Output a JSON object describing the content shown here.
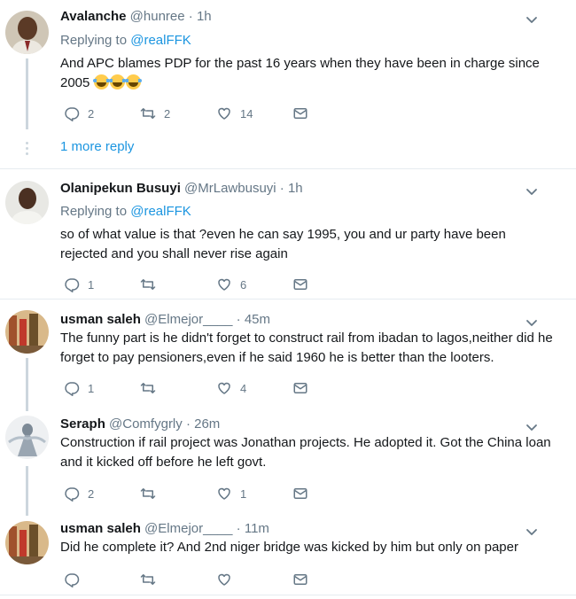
{
  "tweets": [
    {
      "name": "Avalanche",
      "handle": "@hunree",
      "dot": "·",
      "time": "1h",
      "replying_label": "Replying to ",
      "replying_to": "@realFFK",
      "text": "And APC blames PDP for the past 16 years when they have been in charge since 2005 ",
      "emojis": "😂😂😂",
      "replies": "2",
      "retweets": "2",
      "likes": "14",
      "more_reply": "1 more reply"
    },
    {
      "name": "Olanipekun Busuyi",
      "handle": "@MrLawbusuyi",
      "dot": "·",
      "time": "1h",
      "replying_label": "Replying to ",
      "replying_to": "@realFFK",
      "text": "so of what value is that ?even he can say 1995, you and ur party have been rejected and you shall never rise again",
      "replies": "1",
      "retweets": "",
      "likes": "6"
    },
    {
      "name": "usman saleh",
      "handle": "@Elmejor____",
      "dot": "·",
      "time": "45m",
      "text": "The funny part is he didn't forget to construct rail from ibadan to lagos,neither did he forget to pay pensioners,even if he said 1960 he is better than the looters.",
      "replies": "1",
      "retweets": "",
      "likes": "4"
    },
    {
      "name": "Seraph",
      "handle": "@Comfygrly",
      "dot": "·",
      "time": "26m",
      "text": "Construction if rail project was Jonathan projects. He adopted it. Got the China loan and it kicked off before he left govt.",
      "replies": "2",
      "retweets": "",
      "likes": "1"
    },
    {
      "name": "usman saleh",
      "handle": "@Elmejor____",
      "dot": "·",
      "time": "11m",
      "text": "Did he complete it? And 2nd niger bridge was kicked by him but only on paper",
      "replies": "",
      "retweets": "",
      "likes": ""
    }
  ],
  "icons": {
    "reply": "reply-icon",
    "retweet": "retweet-icon",
    "like": "like-icon",
    "dm": "direct-message-icon",
    "more": "chevron-down-icon"
  },
  "colors": {
    "link": "#1b95e0",
    "muted": "#657786",
    "line": "#ccd6dd"
  }
}
